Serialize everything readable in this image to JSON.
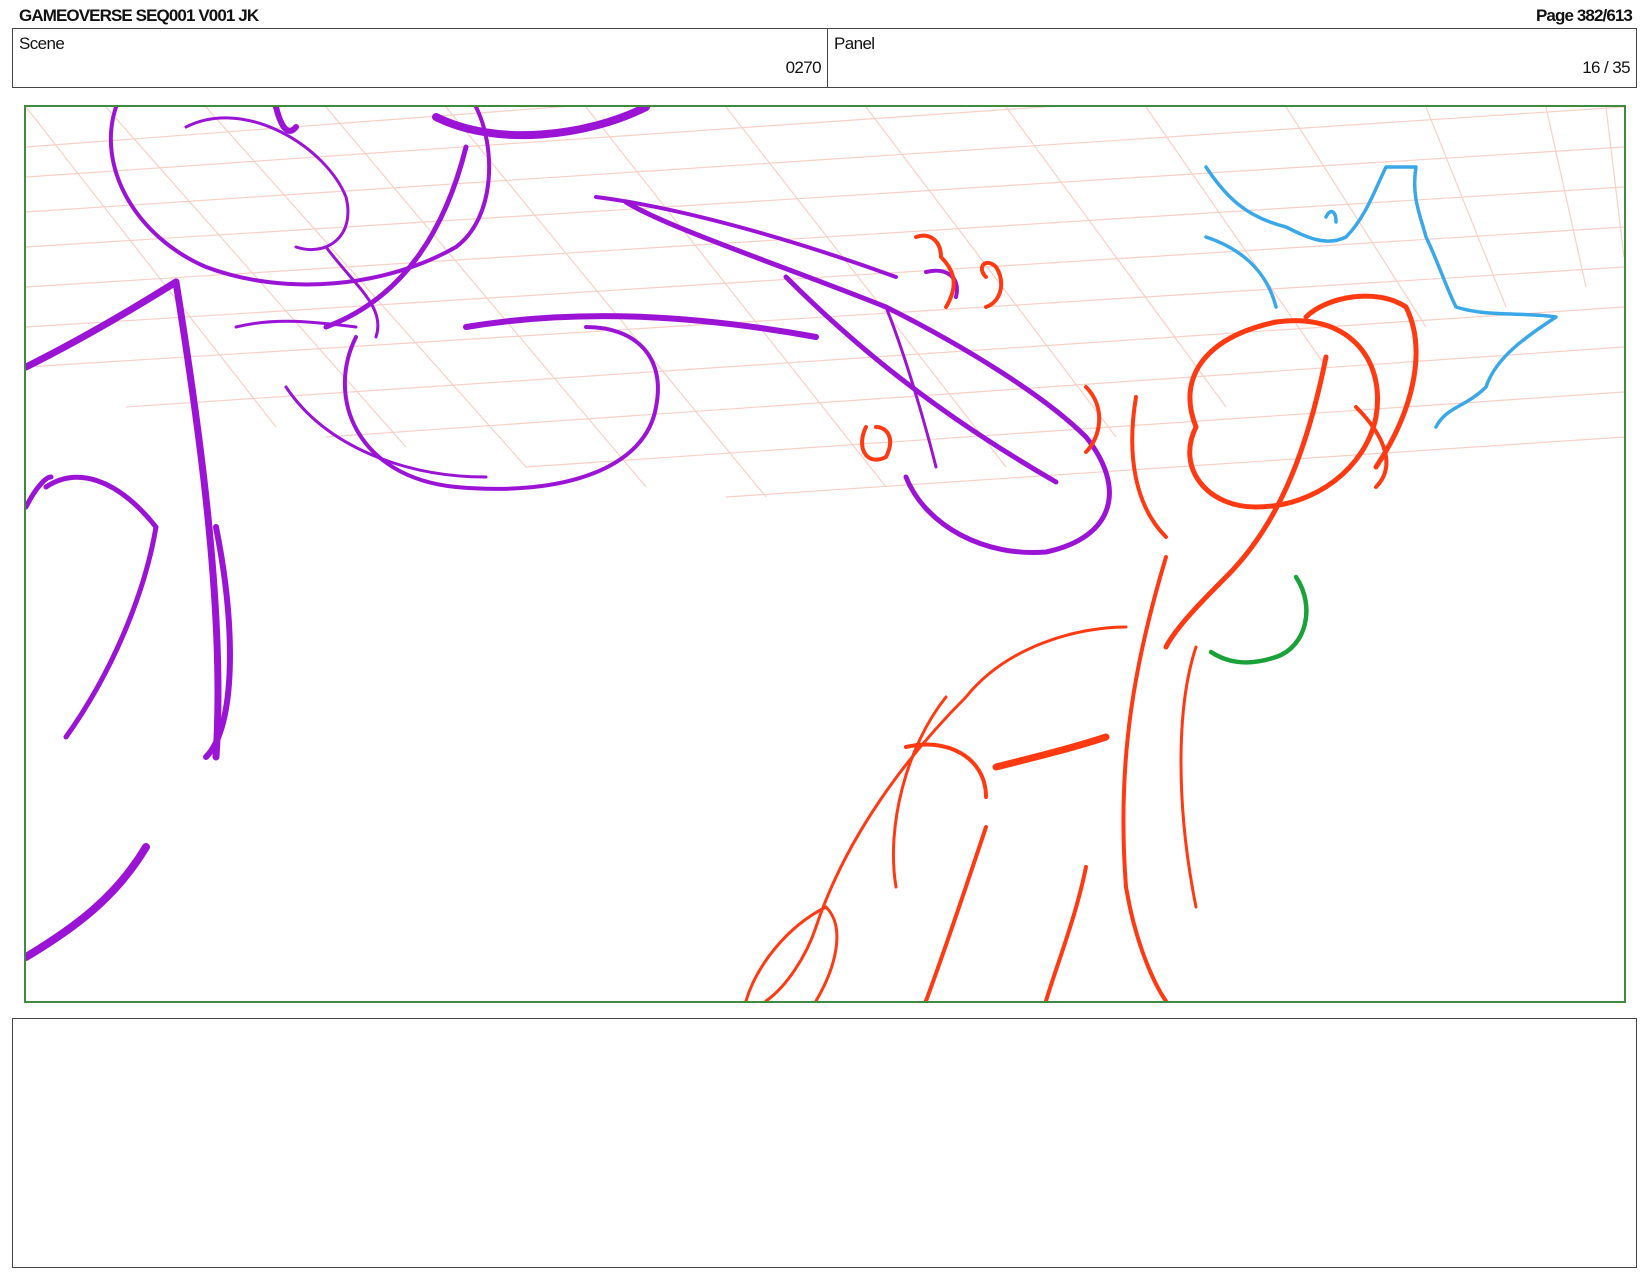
{
  "header": {
    "title": "GAMEOVERSE SEQ001 V001 JK",
    "page": "Page 382/613"
  },
  "info": {
    "scene_label": "Scene",
    "scene_value": "0270",
    "panel_label": "Panel",
    "panel_value": "16 / 35"
  },
  "panel_image": {
    "description_icon": "storyboard-sketch",
    "colors": {
      "frame_border": "#3f8a3f",
      "grid": "#f7c8bd",
      "character_left": "#9b14d6",
      "character_right": "#ff3a12",
      "impact_burst": "#3aa8e8",
      "accent": "#1aa23a"
    }
  },
  "notes": {
    "text": ""
  }
}
